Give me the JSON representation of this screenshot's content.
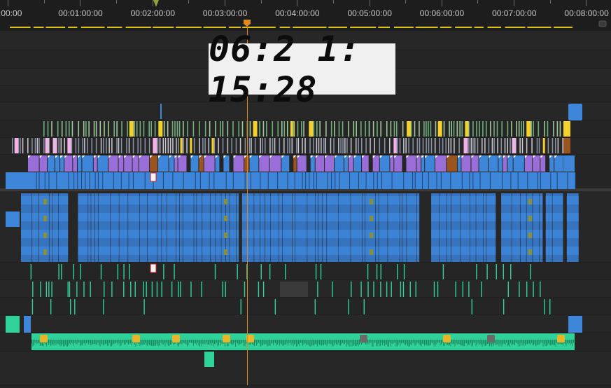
{
  "ruler": {
    "timecodes": [
      ":00:00",
      "00:01:00:00",
      "00:02:00:00",
      "00:03:00:00",
      "00:04:00:00",
      "00:05:00:00",
      "00:06:00:00",
      "00:07:00:00",
      "00:08:00:00"
    ]
  },
  "playhead": {
    "timecode": "06:21:15:28",
    "display": "06:2 1: 15:28"
  },
  "colors": {
    "accent": "#e0861a",
    "work_area": "#d9c21a",
    "video_blue": "#3d86d9",
    "video_purple": "#9a6ed8",
    "video_yellow": "#f4d22a",
    "video_pink": "#f4b0e8",
    "video_brown": "#9a5420",
    "audio_green": "#2fd39a",
    "track_bg": "#262626"
  },
  "icons": {
    "playhead": "playhead-handle-icon",
    "in_marker": "in-point-marker-icon",
    "fx": "fx-badge-icon",
    "marker": "clip-marker-icon",
    "scroll": "navigator-scroll-icon"
  },
  "tracks": [
    {
      "id": "V9",
      "kind": "video"
    },
    {
      "id": "V8",
      "kind": "video"
    },
    {
      "id": "V7",
      "kind": "video"
    },
    {
      "id": "V6",
      "kind": "video"
    },
    {
      "id": "V5",
      "kind": "video"
    },
    {
      "id": "V4",
      "kind": "video"
    },
    {
      "id": "V3",
      "kind": "video"
    },
    {
      "id": "V2",
      "kind": "video"
    },
    {
      "id": "V1",
      "kind": "video"
    },
    {
      "id": "A1",
      "kind": "audio"
    },
    {
      "id": "A2",
      "kind": "audio"
    },
    {
      "id": "A3",
      "kind": "audio"
    },
    {
      "id": "A4",
      "kind": "audio"
    },
    {
      "id": "A5",
      "kind": "audio"
    },
    {
      "id": "A6",
      "kind": "audio"
    },
    {
      "id": "A7",
      "kind": "audio"
    },
    {
      "id": "A8",
      "kind": "audio"
    },
    {
      "id": "A9",
      "kind": "audio"
    }
  ]
}
